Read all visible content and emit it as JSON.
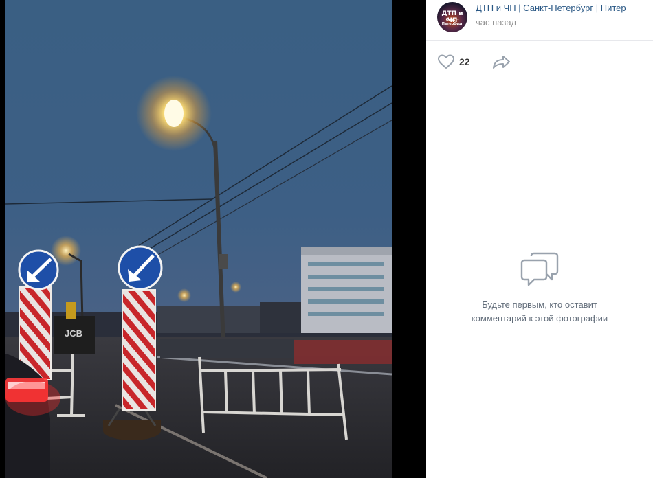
{
  "post": {
    "author": "ДТП и ЧП | Санкт-Петербург | Питер",
    "time": "час назад",
    "avatar_text_1": "ДТП и ЧП",
    "avatar_text_2": "Санкт-Петербург",
    "likes": "22"
  },
  "photo": {
    "truck_label": "JCB"
  },
  "comments": {
    "empty_line_1": "Будьте первым, кто оставит",
    "empty_line_2": "комментарий к этой фотографии"
  },
  "icons": {
    "like": "heart-icon",
    "share": "share-arrow-icon",
    "comments": "speech-bubbles-icon"
  },
  "colors": {
    "link": "#2a5885",
    "muted": "#939393",
    "icon": "#99a2ad",
    "comment_text": "#626d7a"
  }
}
